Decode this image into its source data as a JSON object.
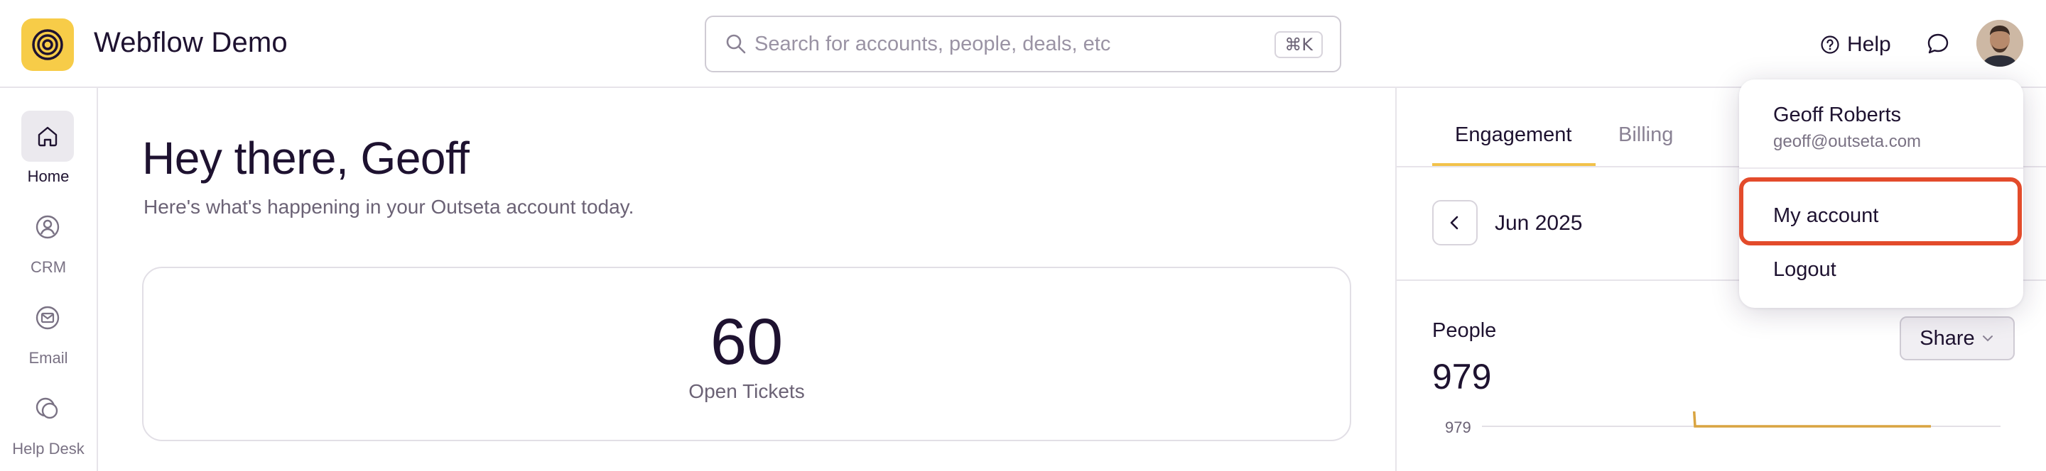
{
  "app": {
    "title": "Webflow Demo"
  },
  "search": {
    "placeholder": "Search for accounts, people, deals, etc",
    "value": "",
    "shortcut": "⌘K"
  },
  "header": {
    "help_label": "Help"
  },
  "sidebar": {
    "items": [
      {
        "label": "Home",
        "icon": "home-icon",
        "active": true
      },
      {
        "label": "CRM",
        "icon": "crm-icon",
        "active": false
      },
      {
        "label": "Email",
        "icon": "email-icon",
        "active": false
      },
      {
        "label": "Help Desk",
        "icon": "help-desk-icon",
        "active": false
      }
    ]
  },
  "main": {
    "greeting": "Hey there, Geoff",
    "subtext": "Here's what's happening in your Outseta account today.",
    "tickets": {
      "count": "60",
      "label": "Open Tickets"
    }
  },
  "right_panel": {
    "tabs": [
      {
        "label": "Engagement",
        "active": true
      },
      {
        "label": "Billing",
        "active": false
      }
    ],
    "month": "Jun 2025",
    "people": {
      "title": "People",
      "value": "979",
      "share_label": "Share",
      "axis_tick": "979"
    }
  },
  "user_menu": {
    "name": "Geoff Roberts",
    "email": "geoff@outseta.com",
    "items": [
      "My account",
      "Logout"
    ]
  },
  "colors": {
    "accent_yellow": "#f7cc48",
    "highlight_red": "#e34b2b",
    "chart_line": "#d9a441",
    "text_primary": "#1e1230",
    "text_secondary": "#6b6275"
  }
}
